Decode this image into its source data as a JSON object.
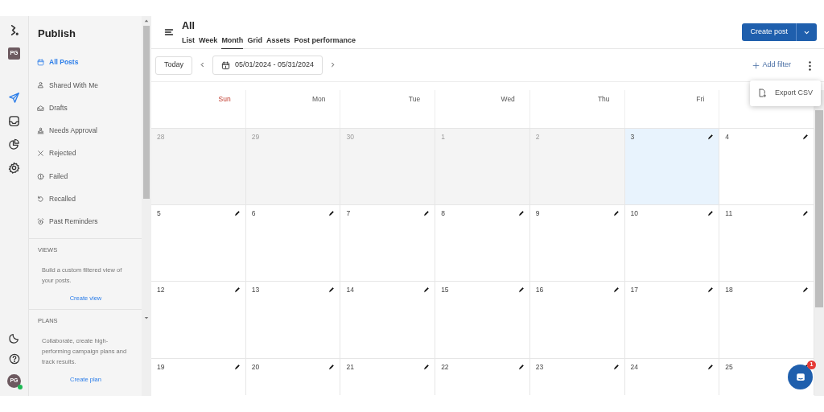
{
  "rail": {
    "top": [
      {
        "kind": "logo",
        "selected": false
      },
      {
        "kind": "workspace",
        "label": "PG",
        "selected": false
      },
      {
        "kind": "publish",
        "selected": true
      },
      {
        "kind": "inbox",
        "selected": false
      },
      {
        "kind": "analytics",
        "selected": false
      },
      {
        "kind": "settings",
        "selected": false
      }
    ],
    "bottom": [
      {
        "kind": "theme"
      },
      {
        "kind": "help"
      },
      {
        "kind": "avatar",
        "label": "PG",
        "online": true
      }
    ]
  },
  "sidebar": {
    "title": "Publish",
    "items": [
      {
        "label": "All Posts",
        "selected": true
      },
      {
        "label": "Shared With Me",
        "selected": false
      },
      {
        "label": "Drafts",
        "selected": false
      },
      {
        "label": "Needs Approval",
        "selected": false
      },
      {
        "label": "Rejected",
        "selected": false
      },
      {
        "label": "Failed",
        "selected": false
      },
      {
        "label": "Recalled",
        "selected": false
      },
      {
        "label": "Past Reminders",
        "selected": false
      }
    ],
    "sections": [
      {
        "heading": "VIEWS",
        "text": "Build a custom filtered view of your posts.",
        "link": "Create view"
      },
      {
        "heading": "PLANS",
        "text": "Collaborate, create high-performing campaign plans and track results.",
        "link": "Create plan"
      }
    ]
  },
  "header": {
    "title": "All",
    "tabs": [
      {
        "label": "List",
        "selected": false
      },
      {
        "label": "Week",
        "selected": false
      },
      {
        "label": "Month",
        "selected": true
      },
      {
        "label": "Grid",
        "selected": false
      },
      {
        "label": "Assets",
        "selected": false
      },
      {
        "label": "Post performance",
        "selected": false
      }
    ],
    "primary_button": "Create post"
  },
  "toolbar": {
    "today_button": "Today",
    "date_range": "05/01/2024 - 05/31/2024",
    "add_filter": "Add filter"
  },
  "menu": {
    "items": [
      {
        "label": "Export CSV"
      }
    ]
  },
  "calendar": {
    "weekdays": [
      {
        "label": "Sun",
        "weekend": true
      },
      {
        "label": "Mon",
        "weekend": false
      },
      {
        "label": "Tue",
        "weekend": false
      },
      {
        "label": "Wed",
        "weekend": false
      },
      {
        "label": "Thu",
        "weekend": false
      },
      {
        "label": "Fri",
        "weekend": false
      }
    ],
    "weeks": [
      [
        {
          "day": "28",
          "past": true,
          "today": false
        },
        {
          "day": "29",
          "past": true,
          "today": false
        },
        {
          "day": "30",
          "past": true,
          "today": false
        },
        {
          "day": "1",
          "past": true,
          "today": false
        },
        {
          "day": "2",
          "past": true,
          "today": false
        },
        {
          "day": "3",
          "past": false,
          "today": true
        },
        {
          "day": "4",
          "past": false,
          "today": false
        }
      ],
      [
        {
          "day": "5",
          "past": false,
          "today": false
        },
        {
          "day": "6",
          "past": false,
          "today": false
        },
        {
          "day": "7",
          "past": false,
          "today": false
        },
        {
          "day": "8",
          "past": false,
          "today": false
        },
        {
          "day": "9",
          "past": false,
          "today": false
        },
        {
          "day": "10",
          "past": false,
          "today": false
        },
        {
          "day": "11",
          "past": false,
          "today": false
        }
      ],
      [
        {
          "day": "12",
          "past": false,
          "today": false
        },
        {
          "day": "13",
          "past": false,
          "today": false
        },
        {
          "day": "14",
          "past": false,
          "today": false
        },
        {
          "day": "15",
          "past": false,
          "today": false
        },
        {
          "day": "16",
          "past": false,
          "today": false
        },
        {
          "day": "17",
          "past": false,
          "today": false
        },
        {
          "day": "18",
          "past": false,
          "today": false
        }
      ],
      [
        {
          "day": "19",
          "past": false,
          "today": false
        },
        {
          "day": "20",
          "past": false,
          "today": false
        },
        {
          "day": "21",
          "past": false,
          "today": false
        },
        {
          "day": "22",
          "past": false,
          "today": false
        },
        {
          "day": "23",
          "past": false,
          "today": false
        },
        {
          "day": "24",
          "past": false,
          "today": false
        },
        {
          "day": "25",
          "past": false,
          "today": false
        }
      ]
    ]
  },
  "chat": {
    "badge": "1"
  }
}
